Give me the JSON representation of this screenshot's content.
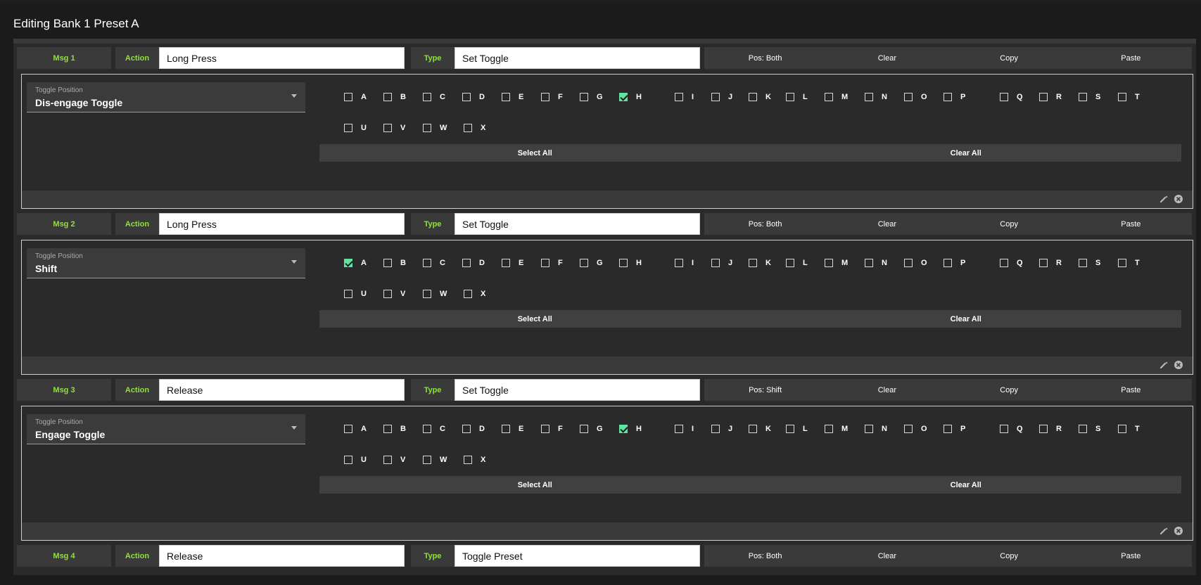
{
  "dialog": {
    "title": "Editing Bank 1 Preset A"
  },
  "ui_labels": {
    "action_tag": "Action",
    "type_tag": "Type",
    "clear": "Clear",
    "copy": "Copy",
    "paste": "Paste",
    "toggle_position_label": "Toggle Position",
    "select_all": "Select All",
    "clear_all": "Clear All"
  },
  "messages": [
    {
      "label": "Msg 1",
      "action": "Long Press",
      "type": "Set Toggle",
      "pos": "Pos: Both",
      "toggle_position": "Dis-engage Toggle",
      "checked": [
        "H"
      ]
    },
    {
      "label": "Msg 2",
      "action": "Long Press",
      "type": "Set Toggle",
      "pos": "Pos: Both",
      "toggle_position": "Shift",
      "checked": [
        "A"
      ]
    },
    {
      "label": "Msg 3",
      "action": "Release",
      "type": "Set Toggle",
      "pos": "Pos: Shift",
      "toggle_position": "Engage Toggle",
      "checked": [
        "H"
      ]
    },
    {
      "label": "Msg 4",
      "action": "Release",
      "type": "Toggle Preset",
      "pos": "Pos: Both"
    }
  ],
  "letters_row1": [
    "A",
    "B",
    "C",
    "D",
    "E",
    "F",
    "G",
    "H",
    "I",
    "J",
    "K",
    "L",
    "M",
    "N",
    "O",
    "P",
    "Q",
    "R",
    "S",
    "T"
  ],
  "letters_row2": [
    "U",
    "V",
    "W",
    "X"
  ],
  "colors": {
    "accent_green": "#8fe23a",
    "check_green": "#5fe3a1",
    "panel": "#2a2a2a"
  }
}
